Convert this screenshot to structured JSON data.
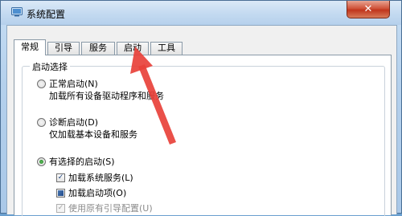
{
  "window": {
    "title": "系统配置",
    "close_glyph": "✕"
  },
  "tabs": [
    {
      "label": "常规",
      "active": true
    },
    {
      "label": "引导",
      "active": false
    },
    {
      "label": "服务",
      "active": false
    },
    {
      "label": "启动",
      "active": false
    },
    {
      "label": "工具",
      "active": false
    }
  ],
  "startup_group": {
    "legend": "启动选择",
    "normal": {
      "label": "正常启动(N)",
      "description": "加载所有设备驱动程序和服务",
      "checked": false
    },
    "diagnostic": {
      "label": "诊断启动(D)",
      "description": "仅加载基本设备和服务",
      "checked": false
    },
    "selective": {
      "label": "有选择的启动(S)",
      "checked": true
    },
    "options": [
      {
        "label": "加载系统服务(L)",
        "state": "checked",
        "glyph": "✓"
      },
      {
        "label": "加载启动项(O)",
        "state": "indeterminate",
        "glyph": ""
      },
      {
        "label": "使用原有引导配置(U)",
        "state": "checked-disabled",
        "glyph": "✓"
      }
    ]
  },
  "colors": {
    "annotation_arrow": "#e8413a",
    "close_button": "#c0351c"
  }
}
